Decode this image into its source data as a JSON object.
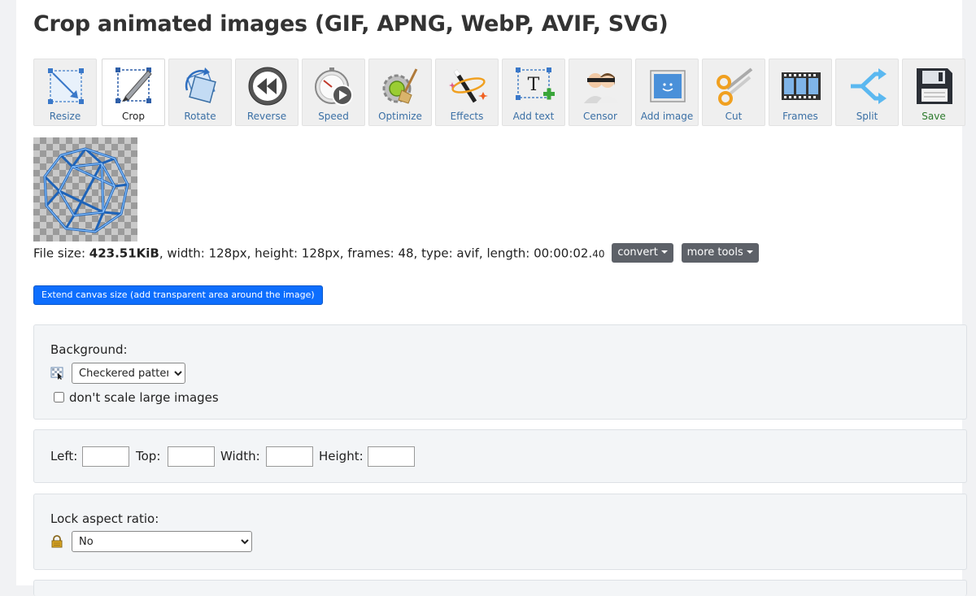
{
  "page": {
    "title": "Crop animated images (GIF, APNG, WebP, AVIF, SVG)"
  },
  "toolbar": {
    "tools": [
      {
        "label": "Resize",
        "icon": "resize-icon"
      },
      {
        "label": "Crop",
        "icon": "crop-icon",
        "active": true
      },
      {
        "label": "Rotate",
        "icon": "rotate-icon"
      },
      {
        "label": "Reverse",
        "icon": "reverse-icon"
      },
      {
        "label": "Speed",
        "icon": "speed-icon"
      },
      {
        "label": "Optimize",
        "icon": "optimize-icon"
      },
      {
        "label": "Effects",
        "icon": "effects-icon"
      },
      {
        "label": "Add text",
        "icon": "add-text-icon"
      },
      {
        "label": "Censor",
        "icon": "censor-icon"
      },
      {
        "label": "Add image",
        "icon": "add-image-icon"
      },
      {
        "label": "Cut",
        "icon": "scissors-icon"
      },
      {
        "label": "Frames",
        "icon": "film-strip-icon"
      },
      {
        "label": "Split",
        "icon": "split-arrows-icon"
      },
      {
        "label": "Save",
        "icon": "floppy-disk-icon"
      }
    ]
  },
  "file_info": {
    "size_label": "File size: ",
    "size_value": "423.51KiB",
    "details": ", width: 128px, height: 128px, frames: 48, type: avif, length: 00:00:02.",
    "length_fraction": "40",
    "convert_label": "convert",
    "more_tools_label": "more tools"
  },
  "extend_button_label": "Extend canvas size (add transparent area around the image)",
  "background_panel": {
    "label": "Background:",
    "selected": "Checkered pattern",
    "checkbox_label": "don't scale large images"
  },
  "crop_fields": {
    "left_label": "Left:",
    "top_label": "Top:",
    "width_label": "Width:",
    "height_label": "Height:"
  },
  "aspect_panel": {
    "label": "Lock aspect ratio:",
    "selected": "No"
  },
  "colors": {
    "primary": "#0d6efd",
    "tool_label": "#3a6fa5",
    "save_label": "#2c7a2c",
    "dropdown_button": "#5d6168"
  }
}
